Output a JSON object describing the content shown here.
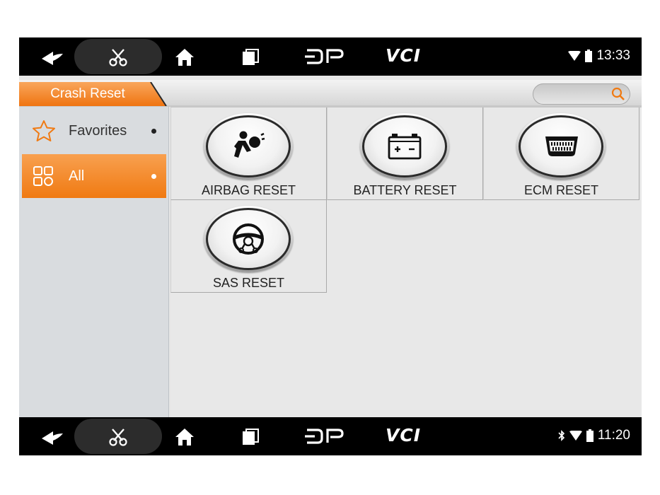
{
  "top_status": {
    "vci_label": "VCI",
    "time": "13:33"
  },
  "bottom_status": {
    "vci_label": "VCI",
    "time": "11:20"
  },
  "header": {
    "tab_title": "Crash Reset",
    "search_placeholder": ""
  },
  "sidebar": {
    "items": [
      {
        "label": "Favorites",
        "icon": "star-icon",
        "selected": false
      },
      {
        "label": "All",
        "icon": "grid-icon",
        "selected": true
      }
    ]
  },
  "functions": [
    {
      "label": "AIRBAG RESET",
      "icon": "airbag-icon"
    },
    {
      "label": "BATTERY RESET",
      "icon": "battery-icon"
    },
    {
      "label": "ECM RESET",
      "icon": "ecm-connector-icon"
    },
    {
      "label": "SAS RESET",
      "icon": "steering-wheel-icon"
    }
  ],
  "colors": {
    "accent": "#f07a12",
    "statusbar": "#000000",
    "sidebar_bg": "#d9dcdf",
    "content_bg": "#e8e8e8"
  }
}
